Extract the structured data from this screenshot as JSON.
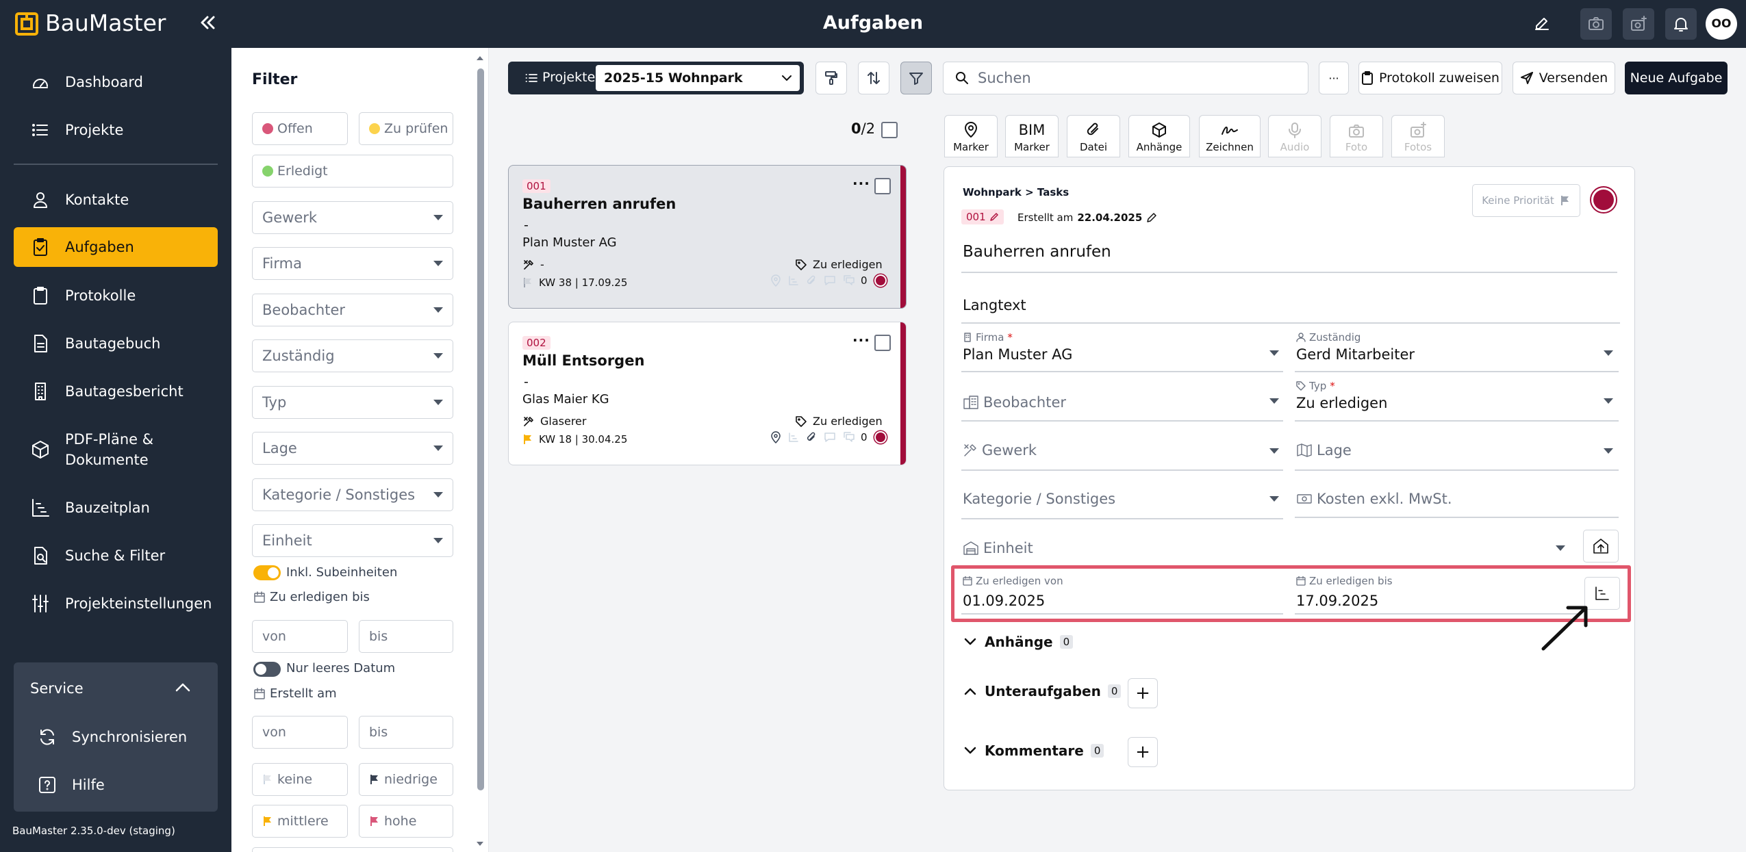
{
  "app": {
    "name": "BauMaster",
    "title": "Aufgaben",
    "avatar_initials": "OO",
    "version": "BauMaster 2.35.0-dev (staging)"
  },
  "colors": {
    "accent": "#f9b208",
    "dark": "#1f2937",
    "task_red": "#a10d3b",
    "highlight": "#e0566b"
  },
  "sidebar": {
    "items": [
      {
        "label": "Dashboard",
        "icon": "gauge-icon"
      },
      {
        "label": "Projekte",
        "icon": "list-icon"
      },
      {
        "label": "Kontakte",
        "icon": "person-icon"
      },
      {
        "label": "Aufgaben",
        "icon": "clipboard-check-icon"
      },
      {
        "label": "Protokolle",
        "icon": "clipboard-icon"
      },
      {
        "label": "Bautagebuch",
        "icon": "document-icon"
      },
      {
        "label": "Bautagesbericht",
        "icon": "building-icon"
      },
      {
        "label": "PDF-Pläne & Dokumente",
        "icon": "cube-icon"
      },
      {
        "label": "Bauzeitplan",
        "icon": "gantt-icon"
      },
      {
        "label": "Suche & Filter",
        "icon": "search-doc-icon"
      },
      {
        "label": "Projekteinstellungen",
        "icon": "sliders-icon"
      }
    ],
    "service": {
      "label": "Service",
      "items": [
        {
          "label": "Synchronisieren"
        },
        {
          "label": "Hilfe"
        }
      ]
    }
  },
  "filter": {
    "title": "Filter",
    "status": {
      "offen": "Offen",
      "zu_pruefen": "Zu prüfen",
      "erledigt": "Erledigt"
    },
    "selects": [
      "Gewerk",
      "Firma",
      "Beobachter",
      "Zuständig",
      "Typ",
      "Lage",
      "Kategorie / Sonstiges",
      "Einheit"
    ],
    "inkl_subeinheiten": "Inkl. Subeinheiten",
    "zu_erledigen_bis": "Zu erledigen bis",
    "von": "von",
    "bis": "bis",
    "nur_leeres_datum": "Nur leeres Datum",
    "erstellt_am": "Erstellt am",
    "priorities": {
      "keine": "keine",
      "niedrige": "niedrige",
      "mittlere": "mittlere",
      "hohe": "hohe"
    }
  },
  "toolbar": {
    "projekte_label": "Projekte",
    "project_value": "2025-15 Wohnpark",
    "search_placeholder": "Suchen",
    "more": "···",
    "protokoll_zuweisen": "Protokoll zuweisen",
    "versenden": "Versenden",
    "neue_aufgabe": "Neue Aufgabe"
  },
  "list": {
    "count_selected": "0",
    "count_total": "/2",
    "tasks": [
      {
        "number": "001",
        "title": "Bauherren anrufen",
        "dash": "-",
        "firma": "Plan Muster AG",
        "gewerk": "-",
        "typ": "Zu erledigen",
        "kw": "KW 38 | 17.09.25",
        "comments": "0",
        "dots": "···"
      },
      {
        "number": "002",
        "title": "Müll Entsorgen",
        "dash": "-",
        "firma": "Glas Maier KG",
        "gewerk": "Glaserer",
        "typ": "Zu erledigen",
        "kw": "KW 18 | 30.04.25",
        "comments": "0",
        "dots": "···"
      }
    ]
  },
  "media_tabs": [
    {
      "label": "Marker",
      "icon": "pin-icon",
      "top": ""
    },
    {
      "label": "Marker",
      "icon": "bim-icon",
      "top": "BIM"
    },
    {
      "label": "Datei",
      "icon": "paperclip-icon",
      "top": ""
    },
    {
      "label": "Anhänge",
      "icon": "box-icon",
      "top": ""
    },
    {
      "label": "Zeichnen",
      "icon": "signature-icon",
      "top": ""
    },
    {
      "label": "Audio",
      "icon": "mic-icon",
      "top": ""
    },
    {
      "label": "Foto",
      "icon": "camera-icon",
      "top": ""
    },
    {
      "label": "Fotos",
      "icon": "camera-plus-icon",
      "top": ""
    }
  ],
  "detail": {
    "breadcrumb": "Wohnpark > Tasks",
    "number": "001",
    "erstellt_label": "Erstellt am",
    "erstellt_date": "22.04.2025",
    "priority": "Keine Priorität",
    "title": "Bauherren anrufen",
    "langtext": "Langtext",
    "firma_label": "Firma",
    "firma_required": "*",
    "firma_value": "Plan Muster AG",
    "zustaendig_label": "Zuständig",
    "zustaendig_value": "Gerd Mitarbeiter",
    "beobachter": "Beobachter",
    "typ_label": "Typ",
    "typ_required": "*",
    "typ_value": "Zu erledigen",
    "gewerk": "Gewerk",
    "lage": "Lage",
    "kategorie": "Kategorie / Sonstiges",
    "kosten": "Kosten exkl. MwSt.",
    "einheit": "Einheit",
    "von_label": "Zu erledigen von",
    "von_value": "01.09.2025",
    "bis_label": "Zu erledigen bis",
    "bis_value": "17.09.2025",
    "anhaenge": "Anhänge",
    "anhaenge_count": "0",
    "unteraufgaben": "Unteraufgaben",
    "unteraufgaben_count": "0",
    "kommentare": "Kommentare",
    "kommentare_count": "0",
    "plus": "+"
  }
}
